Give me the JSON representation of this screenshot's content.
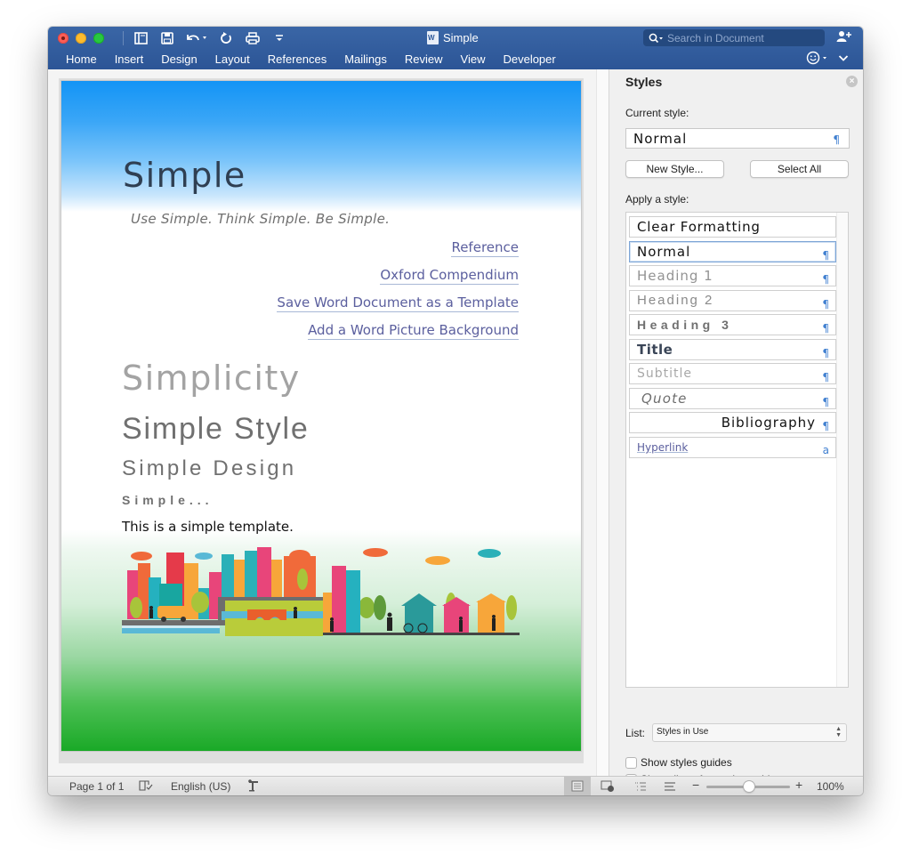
{
  "app": {
    "document_title": "Simple",
    "search_placeholder": "Search in Document"
  },
  "quick_access": [
    {
      "name": "sidebar-toggle-icon"
    },
    {
      "name": "save-icon"
    },
    {
      "name": "undo-icon"
    },
    {
      "name": "redo-icon"
    },
    {
      "name": "print-icon"
    },
    {
      "name": "customize-toolbar-icon"
    }
  ],
  "ribbon": {
    "tabs": [
      "Home",
      "Insert",
      "Design",
      "Layout",
      "References",
      "Mailings",
      "Review",
      "View",
      "Developer"
    ]
  },
  "document": {
    "title": "Simple",
    "subtitle": "Use Simple. Think Simple. Be Simple.",
    "links": [
      "Reference",
      "Oxford Compendium",
      "Save Word Document as a Template",
      "Add a Word Picture Background"
    ],
    "heading1": "Simplicity",
    "heading2": "Simple Style",
    "heading3": "Simple Design",
    "heading4": "Simple...",
    "body": "This is a simple template."
  },
  "styles_pane": {
    "title": "Styles",
    "current_style_label": "Current style:",
    "current_style_value": "Normal",
    "new_style_button": "New Style...",
    "select_all_button": "Select All",
    "apply_label": "Apply a style:",
    "pilcrow": "¶",
    "char_marker": "a",
    "styles": [
      {
        "label": "Clear Formatting",
        "marker": ""
      },
      {
        "label": "Normal",
        "marker": "¶",
        "selected": true
      },
      {
        "label": "Heading 1",
        "marker": "¶"
      },
      {
        "label": "Heading 2",
        "marker": "¶"
      },
      {
        "label": "Heading 3",
        "marker": "¶"
      },
      {
        "label": "Title",
        "marker": "¶"
      },
      {
        "label": "Subtitle",
        "marker": "¶"
      },
      {
        "label": "Quote",
        "marker": "¶"
      },
      {
        "label": "Bibliography",
        "marker": "¶"
      },
      {
        "label": "Hyperlink",
        "marker": "a"
      }
    ],
    "list_label": "List:",
    "list_value": "Styles in Use",
    "show_styles_guides": "Show styles guides",
    "show_direct_formatting_guides": "Show direct formatting guides",
    "show_styles_guides_checked": false,
    "show_direct_formatting_guides_checked": false
  },
  "status_bar": {
    "page": "Page 1 of 1",
    "language": "English (US)",
    "zoom": "100%",
    "zoom_minus": "−",
    "zoom_plus": "+",
    "active_view": "print-layout"
  },
  "colors": {
    "ribbon_blue": "#2c5596",
    "link_color": "#5b5f9e",
    "pilcrow_blue": "#3f7fd0"
  }
}
